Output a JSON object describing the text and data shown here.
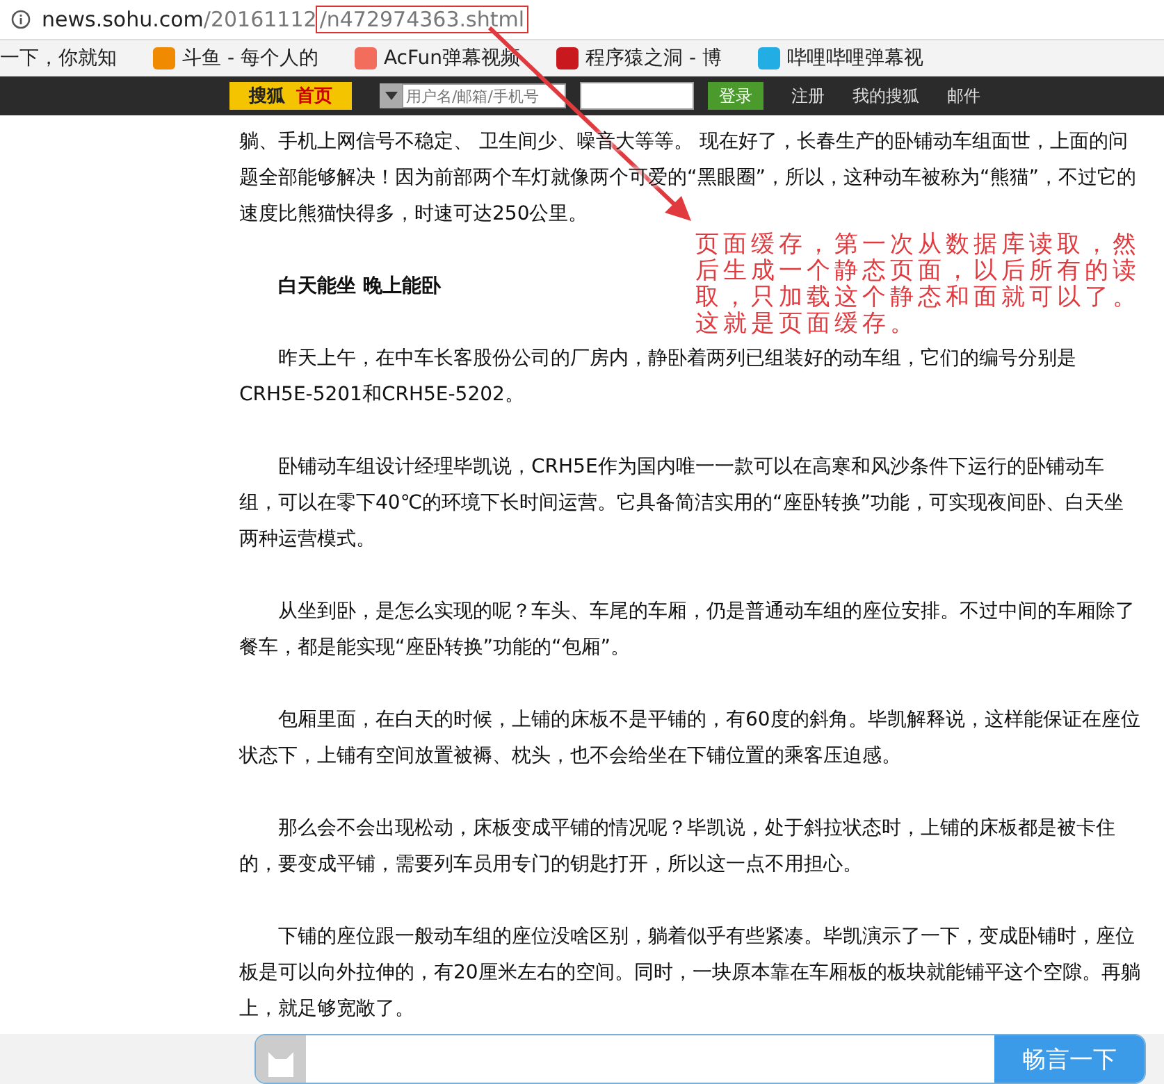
{
  "address_bar": {
    "host": "news.sohu.com",
    "path": "/20161112",
    "highlighted_path": "/n472974363.shtml"
  },
  "bookmarks": [
    {
      "label": "一下，你就知"
    },
    {
      "label": "斗鱼 - 每个人的"
    },
    {
      "label": "AcFun弹幕视频"
    },
    {
      "label": "程序猿之洞 - 博"
    },
    {
      "label": "哔哩哔哩弹幕视"
    }
  ],
  "site_nav": {
    "logo": "搜狐",
    "home": "首页",
    "username_placeholder": "用户名/邮箱/手机号",
    "login": "登录",
    "links": [
      "注册",
      "我的搜狐",
      "邮件"
    ]
  },
  "article": [
    {
      "kind": "text",
      "indent": false,
      "text": "躺、手机上网信号不稳定、 卫生间少、噪音大等等。 现在好了，长春生产的卧铺动车组面世，上面的问题全部能够解决！因为前部两个车灯就像两个可爱的“黑眼圈”，所以，这种动车被称为“熊猫”，不过它的速度比熊猫快得多，时速可达250公里。"
    },
    {
      "kind": "heading",
      "indent": true,
      "text": "白天能坐 晚上能卧"
    },
    {
      "kind": "text",
      "indent": true,
      "text": "昨天上午，在中车长客股份公司的厂房内，静卧着两列已组装好的动车组，它们的编号分别是CRH5E-5201和CRH5E-5202。"
    },
    {
      "kind": "text",
      "indent": true,
      "text": "卧铺动车组设计经理毕凯说，CRH5E作为国内唯一一款可以在高寒和风沙条件下运行的卧铺动车组，可以在零下40℃的环境下长时间运营。它具备简洁实用的“座卧转换”功能，可实现夜间卧、白天坐两种运营模式。"
    },
    {
      "kind": "text",
      "indent": true,
      "text": "从坐到卧，是怎么实现的呢？车头、车尾的车厢，仍是普通动车组的座位安排。不过中间的车厢除了餐车，都是能实现“座卧转换”功能的“包厢”。"
    },
    {
      "kind": "text",
      "indent": true,
      "text": "包厢里面，在白天的时候，上铺的床板不是平铺的，有60度的斜角。毕凯解释说，这样能保证在座位状态下，上铺有空间放置被褥、枕头，也不会给坐在下铺位置的乘客压迫感。"
    },
    {
      "kind": "text",
      "indent": true,
      "text": "那么会不会出现松动，床板变成平铺的情况呢？毕凯说，处于斜拉状态时，上铺的床板都是被卡住的，要变成平铺，需要列车员用专门的钥匙打开，所以这一点不用担心。"
    },
    {
      "kind": "text",
      "indent": true,
      "text": "下铺的座位跟一般动车组的座位没啥区别，躺着似乎有些紧凑。毕凯演示了一下，变成卧铺时，座位板是可以向外拉伸的，有20厘米左右的空间。同时，一块原本靠在车厢板的板块就能铺平这个空隙。再躺上，就足够宽敞了。"
    }
  ],
  "annotation": {
    "text": "页面缓存，第一次从数据库读取，然后生成一个静态页面，以后所有的读取，只加载这个静态和面就可以了。这就是页面缓存。"
  },
  "comment_bar": {
    "button": "畅言一下"
  }
}
